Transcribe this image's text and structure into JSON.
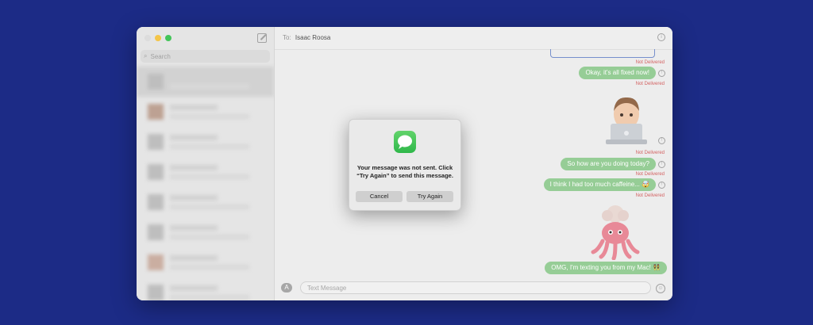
{
  "sidebar": {
    "search_placeholder": "Search"
  },
  "header": {
    "to_label": "To:",
    "recipient": "Isaac Roosa"
  },
  "messages": [
    {
      "status": "Not Delivered"
    },
    {
      "text": "Okay, it's all fixed now!",
      "status": "Not Delivered"
    },
    {
      "sticker": "memoji-laptop",
      "status": "Not Delivered"
    },
    {
      "text": "So how are you doing today?",
      "status": "Not Delivered"
    },
    {
      "text": "I think I had too much caffeine... 🤯",
      "status": "Not Delivered"
    },
    {
      "sticker": "memoji-octopus-exploding-head"
    },
    {
      "text": "OMG, I'm texting you from my Mac! 👯‍♀️"
    }
  ],
  "composer": {
    "placeholder": "Text Message"
  },
  "dialog": {
    "message": "Your message was not sent. Click “Try Again” to send this message.",
    "cancel_label": "Cancel",
    "try_again_label": "Try Again"
  },
  "colors": {
    "background": "#1c2b86",
    "bubble_undelivered": "#8ec98e",
    "not_delivered_text": "#d05454"
  }
}
